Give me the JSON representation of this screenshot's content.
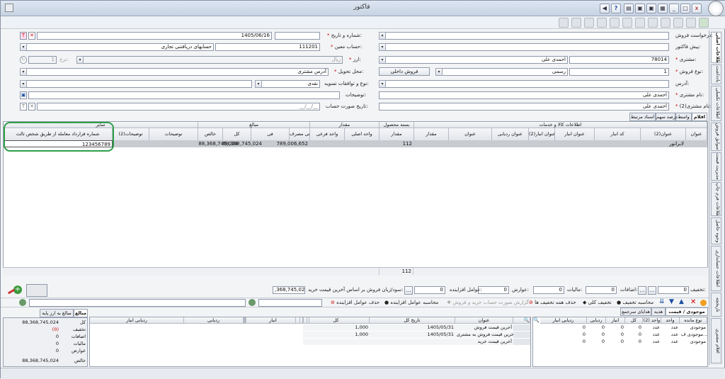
{
  "window": {
    "title": "فاکتور"
  },
  "titlebar": {
    "help": "?",
    "close": "x"
  },
  "sidebar_tabs": [
    "اطلاعات اصلی",
    "یادداشت",
    "اطلاعات تکمیلی",
    "سوابق فروش",
    "مدیریت قیمت",
    "اطلاعات فرم چاپ",
    "وجوه حاصل",
    "اطلاعات حسابداری",
    "تاریخچه",
    "اقلام مشتری"
  ],
  "form": {
    "darkhast_label": "درخواست فروش:",
    "number_date_label": "شماره و تاریخ:",
    "date_value": "1405/06/16",
    "pishfactor_label": "پیش فاکتور:",
    "hesab_label": "حساب معین:",
    "hesab_code": "111201",
    "hesab_name": "حسابهای دریافتنی تجاری",
    "moshtari_label": "مشتری:",
    "moshtari_code": "78014",
    "moshtari_name": "احمدی علی",
    "arz_label": "ارز:",
    "arz_value": "ریال",
    "nerkh_label": "نرخ:",
    "nerkh_value": "1",
    "no_forush_label": "نوع فروش:",
    "no_forush_code": "1",
    "no_forush_value": "رسمی",
    "no_forush_extra": "فروش داخلی",
    "mahal_label": "محل تحویل:",
    "mahal_value": "آدرس مشتری",
    "adres_label": "آدرس:",
    "tasvie_label": "نوع و توافقات تسویه:",
    "tasvie_value": "نقدی",
    "nam_moshtari_label": "نام مشتری:",
    "nam_moshtari_value": "احمدی علی",
    "tozihat_label": "توضیحات:",
    "nam_moshtari2_label": "نام مشتری(2):",
    "nam_moshtari2_value": "احمدی علی",
    "tarikh_surat_label": "تاریخ صورت حساب:",
    "tarikh_surat_value": "__/__/__"
  },
  "tabs": [
    "اقلام",
    "واسط",
    "درصد سهم",
    "اسناد مرتبط"
  ],
  "grid": {
    "group_headers": [
      "اطلاعات کالا و خدمات",
      "بسته محصول",
      "مقدار",
      "مبالغ",
      "سایر"
    ],
    "headers": [
      "عنوان",
      "عنوان(2)",
      "کد انبار",
      "عنوان انبار",
      "عنوان انبار(2)",
      "عنوان ردیابی",
      "عنوان",
      "مقدار",
      "مقدار",
      "واحد اصلی",
      "واحد فرعی",
      "فی مصرف ...",
      "فی",
      "کل",
      "خالص",
      "توضیحات",
      "توضیحات(2)",
      "شماره قرارداد معامله از طریق شخص ثالث"
    ],
    "row": {
      "onvan": "لابراتور",
      "megdar": "112",
      "fi": "789,006,652",
      "kol": "88,368,745,024",
      "khales": "88,368,745,024",
      "gharardad": "123456789"
    },
    "footer_megdar": "112"
  },
  "bar2": {
    "takhfif_label": "تخفیف:",
    "takhfif_value": "0",
    "ezafat_label": "اضافات:",
    "ezafat_value": "0",
    "maliat_label": "مالیات:",
    "maliat_value": "0",
    "avarez_label": "عوارض:",
    "avarez_value": "0",
    "afzayande_label": "عوامل افزاینده:",
    "afzayande_value": "0",
    "sood_label": "سود/زیان فروش بر اساس آخرین قیمت خرید:",
    "sood_value": ",368,745,024"
  },
  "bar3": {
    "mohasebe_takhfif": "محاسبه تخفیف",
    "takhfif_koli": "تخفیف کلی",
    "hazf_takhfif": "حذف همه تخفیف ها",
    "gozaresh": "گزارش صورت حساب خرید و فروش",
    "mohasebe_afzayande": "محاسبه عوامل افزاینده",
    "hazf_afzayande": "حذف عوامل افزاینده"
  },
  "bottom": {
    "right_tabs": [
      "موجودی / قیمت",
      "هدیه",
      "هدایای سرجمع"
    ],
    "stock_headers": [
      "نوع مانده",
      "واحد",
      "واحد (2)",
      "کل",
      "انبار",
      "ردیابی",
      "ردیابی انبار"
    ],
    "stock_rows": [
      {
        "type": "موجودی",
        "unit": "عدد",
        "unit2": "عدد",
        "kol": "0",
        "anbar": "0",
        "radyabi": "0",
        "radyabi_anbar": "0"
      },
      {
        "type": "موجودی ف...",
        "unit": "عدد",
        "unit2": "عدد",
        "kol": "0",
        "anbar": "0",
        "radyabi": "0",
        "radyabi_anbar": "0"
      },
      {
        "type": "موجودی",
        "unit": "عدد",
        "unit2": "عدد",
        "kol": "0",
        "anbar": "0",
        "radyabi": "0",
        "radyabi_anbar": "0"
      }
    ],
    "price_headers": [
      "عنوان",
      "تاریخ کل",
      "کل",
      "انبار",
      "ردیابی",
      "ردیابی انبار"
    ],
    "price_rows": [
      {
        "title": "آخرین قیمت فروش",
        "date": "1405/05/31",
        "kol": "1,000"
      },
      {
        "title": "آخرین قیمت فروش به مشتری",
        "date": "1405/05/31",
        "kol": "1,000"
      },
      {
        "title": "آخرین قیمت خرید",
        "date": "",
        "kol": ""
      }
    ],
    "sum_tabs": [
      "مبالغ",
      "مبالغ به ارز پایه"
    ],
    "sums": [
      {
        "label": "کل",
        "value": "88,368,745,024"
      },
      {
        "label": "تخفیف",
        "value": "(0)"
      },
      {
        "label": "اضافات",
        "value": "0"
      },
      {
        "label": "مالیات",
        "value": "0"
      },
      {
        "label": "عوارض",
        "value": "0"
      },
      {
        "label": "خالص",
        "value": "88,368,745,024"
      }
    ]
  }
}
